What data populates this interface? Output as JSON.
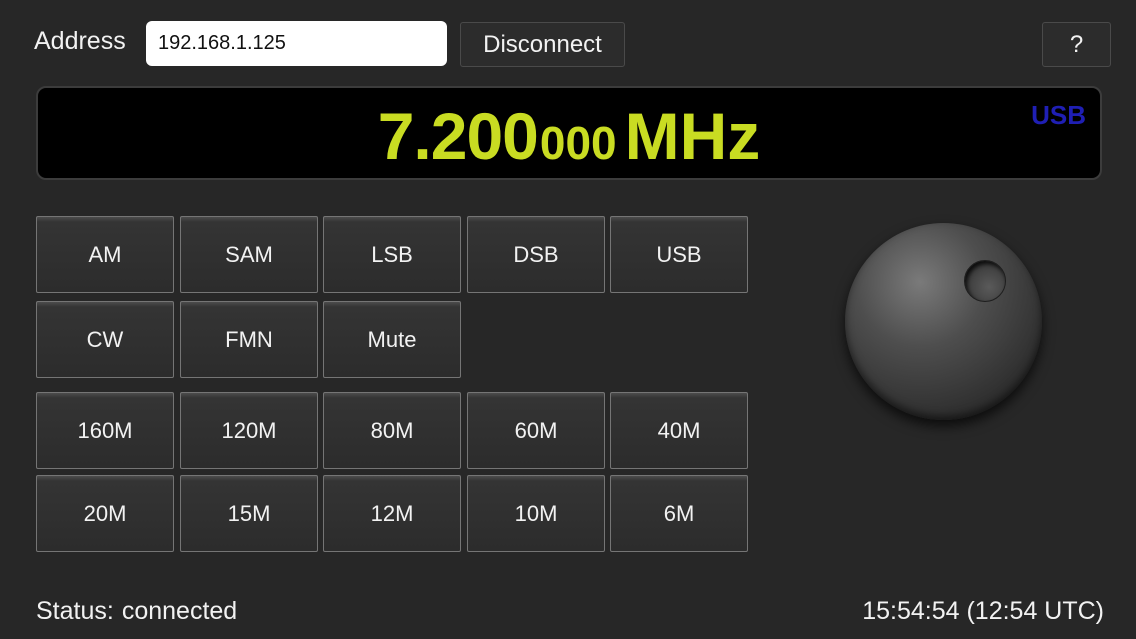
{
  "header": {
    "address_label": "Address",
    "address_value": "192.168.1.125",
    "disconnect_label": "Disconnect",
    "help_label": "?"
  },
  "display": {
    "freq_main": "7.200",
    "freq_sub": "000",
    "freq_unit": "MHz",
    "mode": "USB",
    "freq_color": "#c9dc22",
    "mode_color": "#1f1fb4"
  },
  "modes": [
    "AM",
    "SAM",
    "LSB",
    "DSB",
    "USB",
    "CW",
    "FMN",
    "Mute"
  ],
  "bands": [
    "160M",
    "120M",
    "80M",
    "60M",
    "40M",
    "20M",
    "15M",
    "12M",
    "10M",
    "6M"
  ],
  "tuning_knob": {
    "icon": "tuning-knob"
  },
  "footer": {
    "status_label": "Status:",
    "status_value": "connected",
    "time": "15:54:54 (12:54 UTC)"
  }
}
